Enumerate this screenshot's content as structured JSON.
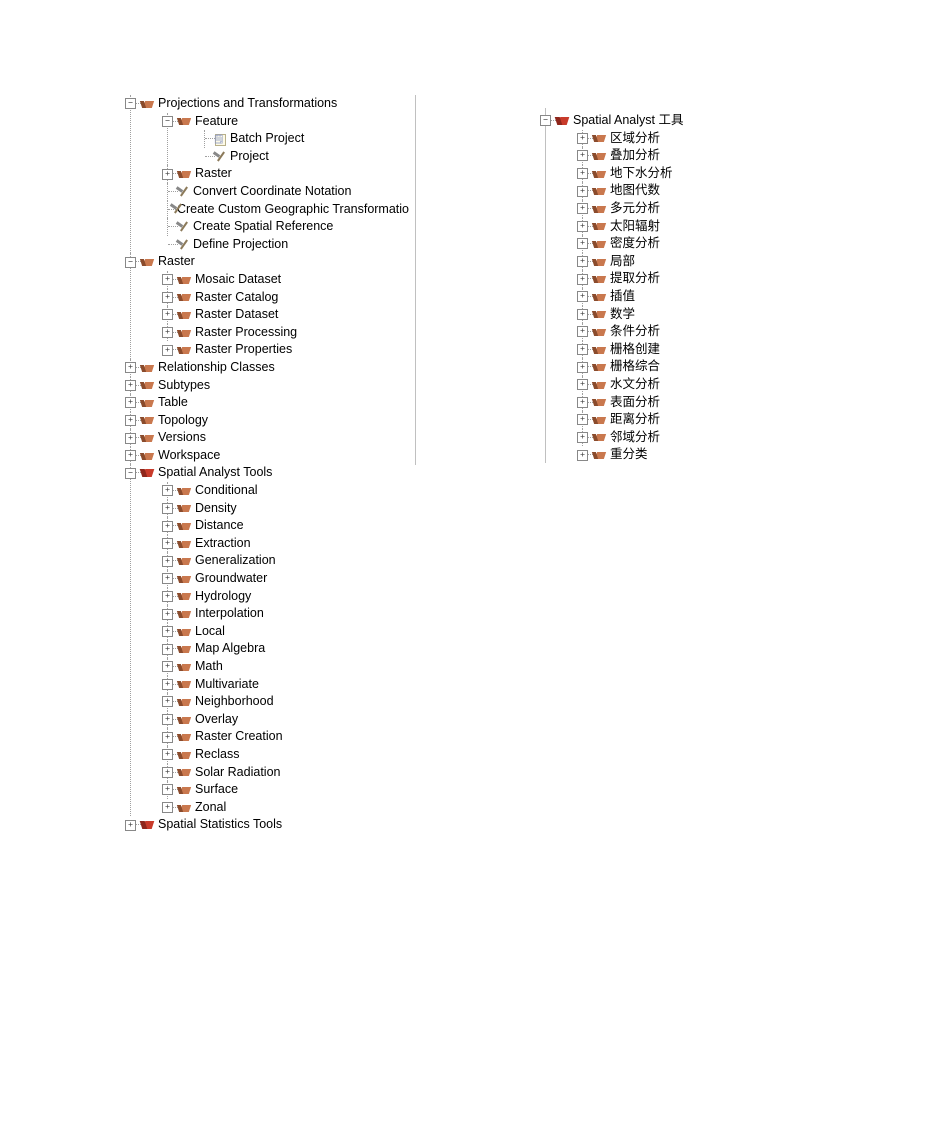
{
  "left_tree": [
    {
      "exp": "minus",
      "icon": "tset",
      "label": "Projections and Transformations",
      "children": [
        {
          "exp": "minus",
          "icon": "tset",
          "label": "Feature",
          "children": [
            {
              "exp": "none",
              "icon": "script",
              "label": "Batch Project"
            },
            {
              "exp": "none",
              "icon": "hammer",
              "label": "Project"
            }
          ]
        },
        {
          "exp": "plus",
          "icon": "tset",
          "label": "Raster"
        },
        {
          "exp": "none",
          "icon": "hammer",
          "label": "Convert Coordinate Notation"
        },
        {
          "exp": "none",
          "icon": "hammer",
          "label": "Create Custom Geographic Transformatio"
        },
        {
          "exp": "none",
          "icon": "hammer",
          "label": "Create Spatial Reference"
        },
        {
          "exp": "none",
          "icon": "hammer",
          "label": "Define Projection"
        }
      ]
    },
    {
      "exp": "minus",
      "icon": "tset",
      "label": "Raster",
      "children": [
        {
          "exp": "plus",
          "icon": "tset",
          "label": "Mosaic Dataset"
        },
        {
          "exp": "plus",
          "icon": "tset",
          "label": "Raster Catalog"
        },
        {
          "exp": "plus",
          "icon": "tset",
          "label": "Raster Dataset"
        },
        {
          "exp": "plus",
          "icon": "tset",
          "label": "Raster Processing"
        },
        {
          "exp": "plus",
          "icon": "tset",
          "label": "Raster Properties"
        }
      ]
    },
    {
      "exp": "plus",
      "icon": "tset",
      "label": "Relationship Classes"
    },
    {
      "exp": "plus",
      "icon": "tset",
      "label": "Subtypes"
    },
    {
      "exp": "plus",
      "icon": "tset",
      "label": "Table"
    },
    {
      "exp": "plus",
      "icon": "tset",
      "label": "Topology"
    },
    {
      "exp": "plus",
      "icon": "tset",
      "label": "Versions"
    },
    {
      "exp": "plus",
      "icon": "tset",
      "label": "Workspace"
    },
    {
      "exp": "minus",
      "icon": "tbx",
      "label": "Spatial Analyst Tools",
      "children": [
        {
          "exp": "plus",
          "icon": "tset",
          "label": "Conditional"
        },
        {
          "exp": "plus",
          "icon": "tset",
          "label": "Density"
        },
        {
          "exp": "plus",
          "icon": "tset",
          "label": "Distance"
        },
        {
          "exp": "plus",
          "icon": "tset",
          "label": "Extraction"
        },
        {
          "exp": "plus",
          "icon": "tset",
          "label": "Generalization"
        },
        {
          "exp": "plus",
          "icon": "tset",
          "label": "Groundwater"
        },
        {
          "exp": "plus",
          "icon": "tset",
          "label": "Hydrology"
        },
        {
          "exp": "plus",
          "icon": "tset",
          "label": "Interpolation"
        },
        {
          "exp": "plus",
          "icon": "tset",
          "label": "Local"
        },
        {
          "exp": "plus",
          "icon": "tset",
          "label": "Map Algebra"
        },
        {
          "exp": "plus",
          "icon": "tset",
          "label": "Math"
        },
        {
          "exp": "plus",
          "icon": "tset",
          "label": "Multivariate"
        },
        {
          "exp": "plus",
          "icon": "tset",
          "label": "Neighborhood"
        },
        {
          "exp": "plus",
          "icon": "tset",
          "label": "Overlay"
        },
        {
          "exp": "plus",
          "icon": "tset",
          "label": "Raster Creation"
        },
        {
          "exp": "plus",
          "icon": "tset",
          "label": "Reclass"
        },
        {
          "exp": "plus",
          "icon": "tset",
          "label": "Solar Radiation"
        },
        {
          "exp": "plus",
          "icon": "tset",
          "label": "Surface"
        },
        {
          "exp": "plus",
          "icon": "tset",
          "label": "Zonal"
        }
      ]
    },
    {
      "exp": "plus",
      "icon": "tbx",
      "label": "Spatial Statistics Tools"
    }
  ],
  "right_tree": [
    {
      "exp": "minus",
      "icon": "tbx",
      "label": "Spatial Analyst 工具",
      "children": [
        {
          "exp": "plus",
          "icon": "tset",
          "label": "区域分析"
        },
        {
          "exp": "plus",
          "icon": "tset",
          "label": "叠加分析"
        },
        {
          "exp": "plus",
          "icon": "tset",
          "label": "地下水分析"
        },
        {
          "exp": "plus",
          "icon": "tset",
          "label": "地图代数"
        },
        {
          "exp": "plus",
          "icon": "tset",
          "label": "多元分析"
        },
        {
          "exp": "plus",
          "icon": "tset",
          "label": "太阳辐射"
        },
        {
          "exp": "plus",
          "icon": "tset",
          "label": "密度分析"
        },
        {
          "exp": "plus",
          "icon": "tset",
          "label": "局部"
        },
        {
          "exp": "plus",
          "icon": "tset",
          "label": "提取分析"
        },
        {
          "exp": "plus",
          "icon": "tset",
          "label": "插值"
        },
        {
          "exp": "plus",
          "icon": "tset",
          "label": "数学"
        },
        {
          "exp": "plus",
          "icon": "tset",
          "label": "条件分析"
        },
        {
          "exp": "plus",
          "icon": "tset",
          "label": "栅格创建"
        },
        {
          "exp": "plus",
          "icon": "tset",
          "label": "栅格综合"
        },
        {
          "exp": "plus",
          "icon": "tset",
          "label": "水文分析"
        },
        {
          "exp": "plus",
          "icon": "tset",
          "label": "表面分析"
        },
        {
          "exp": "plus",
          "icon": "tset",
          "label": "距离分析"
        },
        {
          "exp": "plus",
          "icon": "tset",
          "label": "邻域分析"
        },
        {
          "exp": "plus",
          "icon": "tset",
          "label": "重分类"
        }
      ]
    }
  ]
}
